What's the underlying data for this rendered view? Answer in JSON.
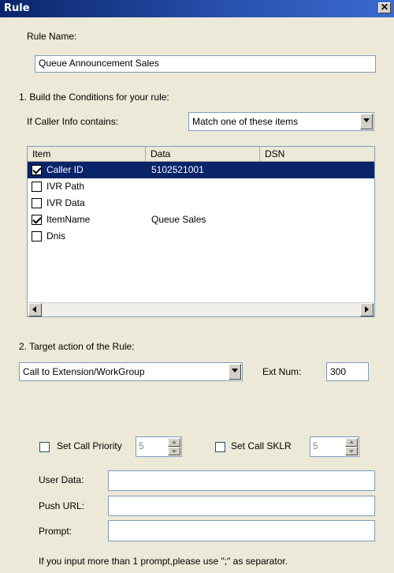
{
  "window": {
    "title": "Rule",
    "close_glyph": "✕"
  },
  "rule_name": {
    "label": "Rule Name:",
    "value": "Queue Announcement Sales"
  },
  "conditions": {
    "heading": "1. Build the Conditions for your rule:",
    "caller_info_label": "If Caller Info contains:",
    "match_value": "Match one of these items",
    "columns": [
      "Item",
      "Data",
      "DSN"
    ],
    "rows": [
      {
        "item": "Caller ID",
        "data": "5102521001",
        "dsn": "",
        "checked": true,
        "selected": true
      },
      {
        "item": "IVR Path",
        "data": "",
        "dsn": "",
        "checked": false,
        "selected": false
      },
      {
        "item": "IVR Data",
        "data": "",
        "dsn": "",
        "checked": false,
        "selected": false
      },
      {
        "item": "ItemName",
        "data": "Queue Sales",
        "dsn": "",
        "checked": true,
        "selected": false
      },
      {
        "item": "Dnis",
        "data": "",
        "dsn": "",
        "checked": false,
        "selected": false
      }
    ]
  },
  "target": {
    "heading": "2. Target action of the Rule:",
    "action_value": "Call to Extension/WorkGroup",
    "ext_label": "Ext Num:",
    "ext_value": "300"
  },
  "priority": {
    "label": "Set Call Priority",
    "value": "5",
    "checked": false
  },
  "sklr": {
    "label": "Set Call SKLR",
    "value": "5",
    "checked": false
  },
  "user_data": {
    "label": "User Data:",
    "value": ""
  },
  "push_url": {
    "label": "Push URL:",
    "value": ""
  },
  "prompt": {
    "label": "Prompt:",
    "value": ""
  },
  "note": "If you input more than 1 prompt,please use \";\" as separator."
}
